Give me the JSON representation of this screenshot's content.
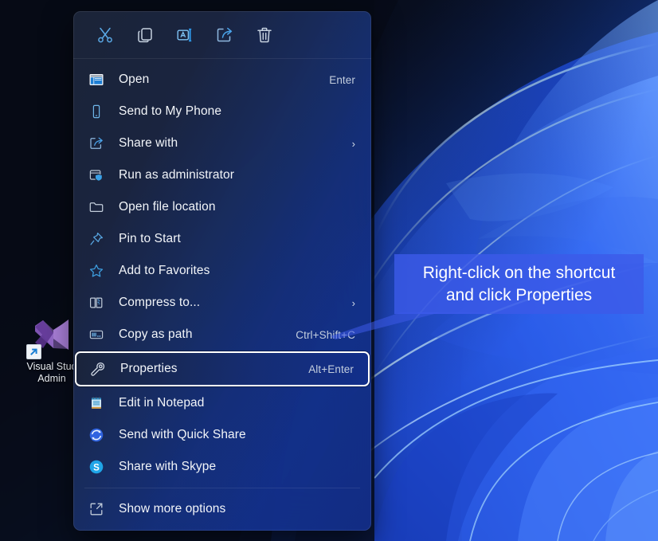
{
  "desktop": {
    "icon": {
      "name": "Visual Studio Admin",
      "label_line1": "Visual Stud",
      "label_line2": "Admin",
      "icon_semantic": "visual-studio-icon",
      "shortcut_overlay": "shortcut-arrow-icon"
    },
    "wallpaper_name": "windows-11-bloom-blue",
    "background_color": "#0a0f1c"
  },
  "context_menu": {
    "command_bar": [
      {
        "name": "cut",
        "icon": "scissors-icon",
        "color": "#5aa9e6"
      },
      {
        "name": "copy",
        "icon": "copy-icon",
        "color": "#c6d2e0"
      },
      {
        "name": "rename",
        "icon": "rename-icon",
        "color": "#7fc3f5"
      },
      {
        "name": "share",
        "icon": "share-icon",
        "color": "#8fb8e0"
      },
      {
        "name": "delete",
        "icon": "trash-icon",
        "color": "#c6d2e0"
      }
    ],
    "items": [
      {
        "label": "Open",
        "accel": "Enter",
        "icon": "window-open-icon",
        "submenu": false,
        "selected": false
      },
      {
        "label": "Send to My Phone",
        "accel": "",
        "icon": "phone-icon",
        "submenu": false,
        "selected": false
      },
      {
        "label": "Share with",
        "accel": "",
        "icon": "share-with-icon",
        "submenu": true,
        "selected": false
      },
      {
        "label": "Run as administrator",
        "accel": "",
        "icon": "shield-window-icon",
        "submenu": false,
        "selected": false
      },
      {
        "label": "Open file location",
        "accel": "",
        "icon": "folder-icon",
        "submenu": false,
        "selected": false
      },
      {
        "label": "Pin to Start",
        "accel": "",
        "icon": "pin-icon",
        "submenu": false,
        "selected": false
      },
      {
        "label": "Add to Favorites",
        "accel": "",
        "icon": "star-icon",
        "submenu": false,
        "selected": false
      },
      {
        "label": "Compress to...",
        "accel": "",
        "icon": "compress-zip-icon",
        "submenu": true,
        "selected": false
      },
      {
        "label": "Copy as path",
        "accel": "Ctrl+Shift+C",
        "icon": "copy-path-icon",
        "submenu": false,
        "selected": false
      },
      {
        "label": "Properties",
        "accel": "Alt+Enter",
        "icon": "wrench-icon",
        "submenu": false,
        "selected": true
      },
      {
        "label": "Edit in Notepad",
        "accel": "",
        "icon": "notepad-icon",
        "submenu": false,
        "selected": false
      },
      {
        "label": "Send with Quick Share",
        "accel": "",
        "icon": "quick-share-icon",
        "submenu": false,
        "selected": false
      },
      {
        "label": "Share with Skype",
        "accel": "",
        "icon": "skype-icon",
        "submenu": false,
        "selected": false
      },
      {
        "label": "Show more options",
        "accel": "",
        "icon": "more-options-icon",
        "submenu": false,
        "selected": false,
        "separator_before": true
      }
    ],
    "selected_item": "Properties",
    "chevron_glyph": "›"
  },
  "callout": {
    "line1": "Right-click on the shortcut",
    "line2": "and click Properties",
    "background_color": "#3c5ae8",
    "text_color": "#ffffff"
  }
}
